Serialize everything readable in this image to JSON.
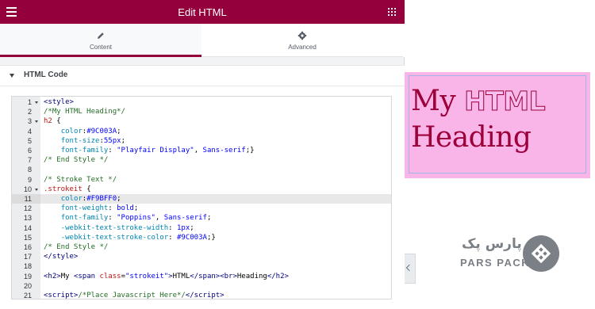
{
  "header": {
    "title": "Edit HTML",
    "menu_icon": "hamburger-icon",
    "apps_icon": "grid-icon"
  },
  "tabs": [
    {
      "label": "Content",
      "icon": "pencil-icon",
      "active": true
    },
    {
      "label": "Advanced",
      "icon": "gear-icon",
      "active": false
    }
  ],
  "section": {
    "label": "HTML Code",
    "expanded": true
  },
  "editor": {
    "active_line": 11,
    "fold_lines": [
      1,
      3,
      10
    ]
  },
  "preview": {
    "heading_line1": "My",
    "heading_stroke": "HTML",
    "heading_line2": "Heading"
  },
  "logo": {
    "text_fa": "پارس پک",
    "text_en": "PARS PACK"
  },
  "colors": {
    "brand": "#93003c",
    "heading": "#9C003A",
    "stroke_fill": "#F9BFF0",
    "preview_bg": "#f9b4e8"
  }
}
